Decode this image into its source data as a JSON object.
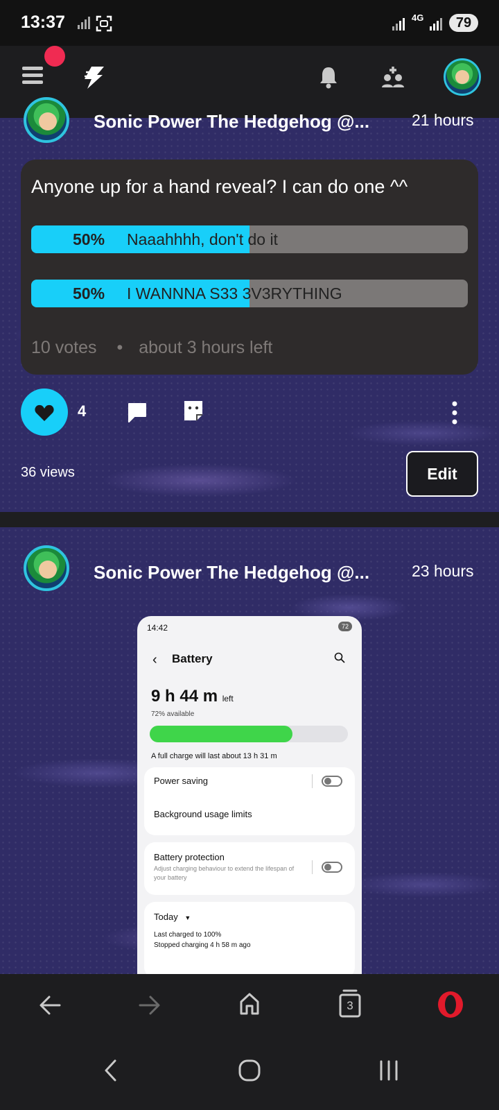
{
  "status_bar": {
    "time": "13:37",
    "network": "4G",
    "battery": "79"
  },
  "app_bar": {
    "icons": [
      "menu-icon",
      "lightning-logo",
      "bell-icon",
      "add-friends-icon",
      "profile-avatar"
    ]
  },
  "posts": [
    {
      "author": "Sonic Power The Hedgehog @...",
      "time": "21 hours",
      "poll": {
        "question": "Anyone up for a hand reveal? I can do one ^^",
        "options": [
          {
            "percent_label": "50%",
            "text": "Naaahhhh, don't do it",
            "fraction": 0.5
          },
          {
            "percent_label": "50%",
            "text": "I WANNNA S33 3V3RYTHING",
            "fraction": 0.5
          }
        ],
        "votes": "10 votes",
        "time_left": "about 3 hours left"
      },
      "likes": "4",
      "views": "36 views",
      "edit_label": "Edit"
    },
    {
      "author": "Sonic Power The Hedgehog @...",
      "time": "23 hours",
      "image": {
        "time": "14:42",
        "battery": "72",
        "title": "Battery",
        "remaining_main": "9 h 44 m",
        "remaining_suffix": "left",
        "available": "72% available",
        "level_fraction": 0.72,
        "full_charge": "A full charge will last about 13 h 31 m",
        "power_saving": "Power saving",
        "background_limits": "Background usage limits",
        "battery_protection": "Battery protection",
        "protection_desc": "Adjust charging behaviour to extend the lifespan of your battery",
        "today": "Today",
        "last_charged": "Last charged to 100%",
        "stopped_charging": "Stopped charging 4 h 58 m ago"
      }
    }
  ],
  "browser_bar": {
    "tabs_count": "3",
    "icons": [
      "back-icon",
      "forward-icon",
      "home-icon",
      "tabs-icon",
      "opera-icon"
    ]
  },
  "colors": {
    "accent": "#18cff9",
    "notif": "#f02b52",
    "opera": "#e11a2b",
    "battery_bar": "#3fd54a"
  }
}
